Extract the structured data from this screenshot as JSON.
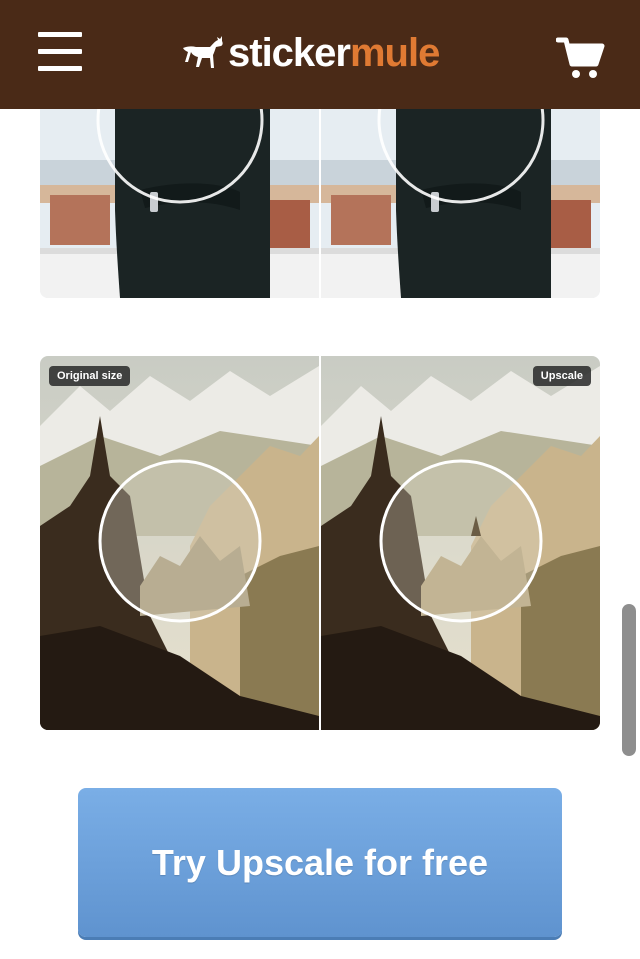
{
  "header": {
    "menu_icon": "hamburger-menu-icon",
    "logo": {
      "part1": "sticker",
      "part2": "mule",
      "mark_icon": "mule-icon"
    },
    "cart_icon": "shopping-cart-icon",
    "colors": {
      "background": "#4a2a17",
      "logo_accent": "#e07a33"
    }
  },
  "comparison": {
    "top_image": {
      "left_badge": "",
      "right_badge": ""
    },
    "bottom_image": {
      "left_badge": "Original size",
      "right_badge": "Upscale"
    }
  },
  "cta": {
    "label": "Try Upscale for free",
    "color": "#6ea2dc"
  }
}
